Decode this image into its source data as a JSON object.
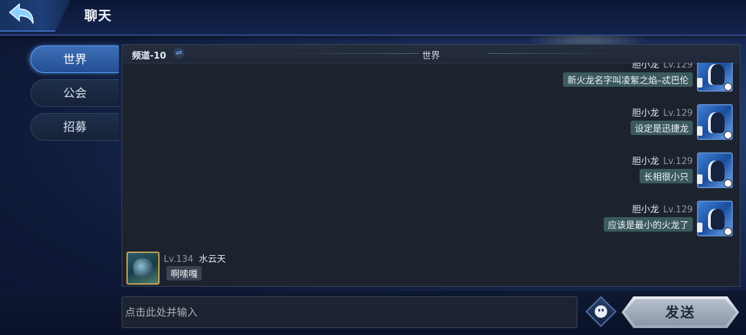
{
  "header": {
    "title": "聊天"
  },
  "tabs": [
    {
      "label": "世界",
      "active": true
    },
    {
      "label": "公会",
      "active": false
    },
    {
      "label": "招募",
      "active": false
    }
  ],
  "panel": {
    "channel": "频道-10",
    "title": "世界"
  },
  "messages": [
    {
      "side": "right",
      "name": "胆小龙",
      "level": "Lv.129",
      "text": "新火龙名字叫凌絮之焰–忒巴伦"
    },
    {
      "side": "right",
      "name": "胆小龙",
      "level": "Lv.129",
      "text": "设定是迅捷龙"
    },
    {
      "side": "right",
      "name": "胆小龙",
      "level": "Lv.129",
      "text": "长相很小只"
    },
    {
      "side": "right",
      "name": "胆小龙",
      "level": "Lv.129",
      "text": "应该是最小的火龙了"
    },
    {
      "side": "left",
      "name": "水云天",
      "level": "Lv.134",
      "text": "啊嗦嘎"
    }
  ],
  "input": {
    "placeholder": "点击此处并输入"
  },
  "send": {
    "label": "发送"
  },
  "colors": {
    "accent": "#3c6fb8",
    "bubble_right": "#3b5a5e",
    "bubble_left": "#3a4452",
    "panel_bg": "#1c232e"
  },
  "icons": [
    "back-arrow-icon",
    "swap-icon",
    "emoji-icon"
  ]
}
